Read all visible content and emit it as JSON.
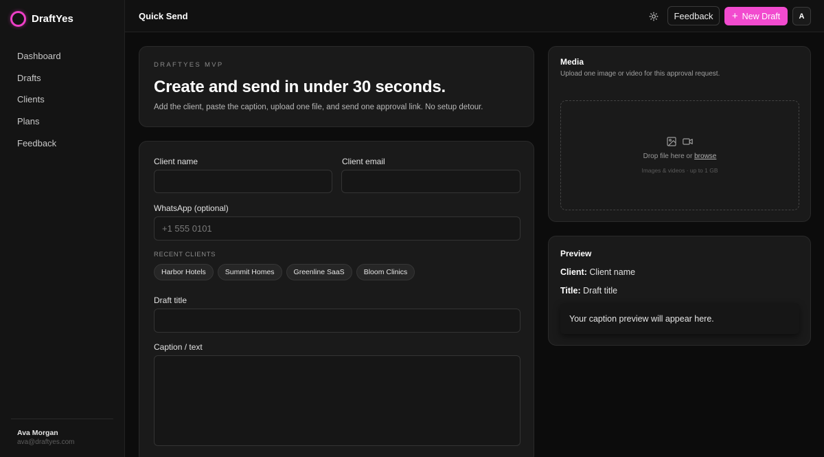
{
  "app": {
    "name": "DraftYes"
  },
  "sidebar": {
    "items": [
      {
        "label": "Dashboard"
      },
      {
        "label": "Drafts"
      },
      {
        "label": "Clients"
      },
      {
        "label": "Plans"
      },
      {
        "label": "Feedback"
      }
    ],
    "user": {
      "name": "Ava Morgan",
      "email": "ava@draftyes.com"
    }
  },
  "header": {
    "title": "Quick Send",
    "theme_icon": "sun-icon",
    "feedback_label": "Feedback",
    "new_draft_label": "New Draft",
    "avatar_initial": "A"
  },
  "hero": {
    "eyebrow": "DRAFTYES MVP",
    "title": "Create and send in under 30 seconds.",
    "subtitle": "Add the client, paste the caption, upload one file, and send one approval link. No setup detour."
  },
  "form": {
    "client_name": {
      "label": "Client name",
      "value": "",
      "placeholder": ""
    },
    "client_email": {
      "label": "Client email",
      "value": "",
      "placeholder": ""
    },
    "whatsapp": {
      "label": "WhatsApp (optional)",
      "value": "",
      "placeholder": "+1 555 0101"
    },
    "recent_clients_label": "RECENT CLIENTS",
    "recent_clients": [
      "Harbor Hotels",
      "Summit Homes",
      "Greenline SaaS",
      "Bloom Clinics"
    ],
    "draft_title": {
      "label": "Draft title",
      "value": "",
      "placeholder": ""
    },
    "caption": {
      "label": "Caption / text",
      "value": "",
      "placeholder": ""
    }
  },
  "media": {
    "title": "Media",
    "subtitle": "Upload one image or video for this approval request.",
    "drop_text": "Drop file here or",
    "browse_label": "browse",
    "hint": "Images & videos · up to 1 GB"
  },
  "preview": {
    "title": "Preview",
    "client_label": "Client:",
    "client_value": "Client name",
    "title_label": "Title:",
    "title_value": "Draft title",
    "caption_placeholder": "Your caption preview will appear here."
  },
  "colors": {
    "accent": "#f24bcf",
    "background": "#0c0c0c",
    "card": "#1a1a1a"
  }
}
